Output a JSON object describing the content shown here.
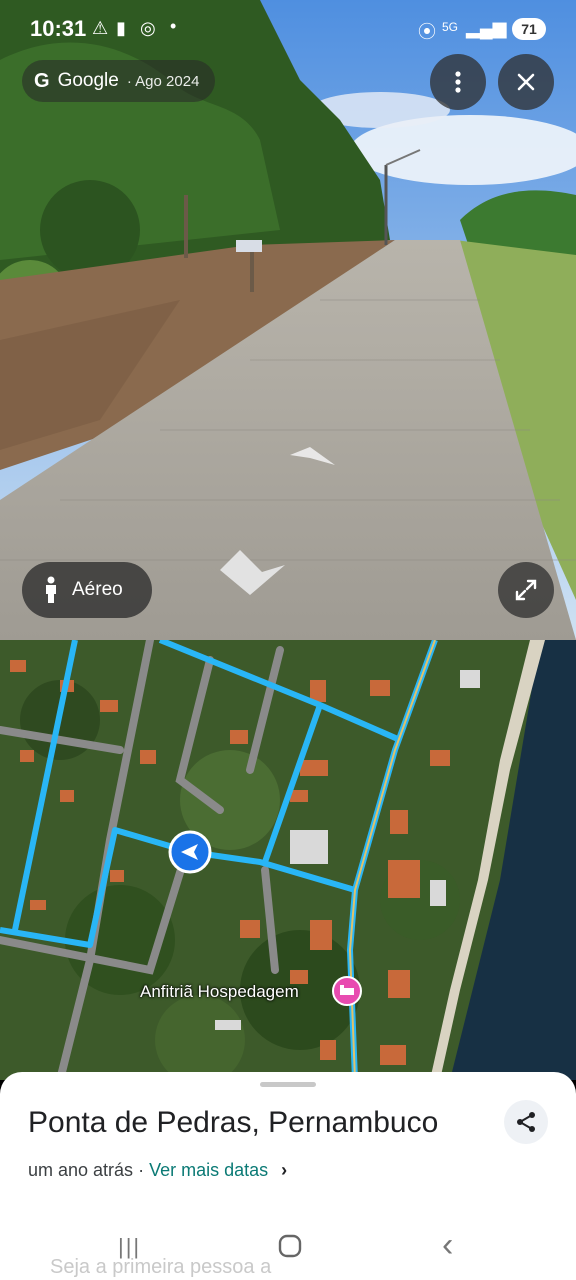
{
  "status_bar": {
    "time": "10:31",
    "icons": [
      "warning-icon",
      "teams-icon",
      "whatsapp-icon",
      "dot-icon"
    ],
    "right_icons": [
      "location-icon",
      "5g-icon",
      "signal-icon",
      "signal-icon"
    ],
    "battery": "71"
  },
  "streetview_header": {
    "brand": "Google",
    "date": "· Ago 2024",
    "menu_icon": "more-vert-icon",
    "close_icon": "close-icon"
  },
  "streetview_controls": {
    "aereo_label": "Aéreo",
    "aereo_icon": "person-icon",
    "expand_icon": "expand-icon"
  },
  "map": {
    "place_label": "Anfitriã Hospedagem",
    "place_icon": "hotel-icon",
    "user_icon": "navigation-arrow-icon"
  },
  "sheet": {
    "title": "Ponta de Pedras, Pernambuco",
    "subtitle": "um ano atrás",
    "separator": "·",
    "more_link": "Ver mais datas",
    "chevron": "›",
    "share_icon": "share-icon",
    "footer_text": "Seja a primeira pessoa a"
  },
  "nav_bar": {
    "recents": "|||",
    "home": "○",
    "back": "‹"
  },
  "colors": {
    "route": "#29b6f6",
    "teal_link": "#0b7a75",
    "user_marker": "#1a73e8",
    "hotel_pin": "#e84bb0"
  }
}
